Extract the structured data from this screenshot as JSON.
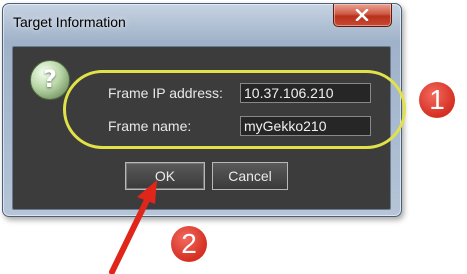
{
  "dialog": {
    "title": "Target Information",
    "close_icon": "close-icon"
  },
  "form": {
    "icon": "question-icon",
    "icon_glyph": "?",
    "ip_label": "Frame IP address:",
    "ip_value": "10.37.106.210",
    "name_label": "Frame name:",
    "name_value": "myGekko210"
  },
  "buttons": {
    "ok_label": "OK",
    "cancel_label": "Cancel"
  },
  "annotations": {
    "step1": "1",
    "step2": "2",
    "highlight_color": "#e1e24a",
    "badge_color": "#d42f22",
    "arrow_color": "#e0261a"
  }
}
